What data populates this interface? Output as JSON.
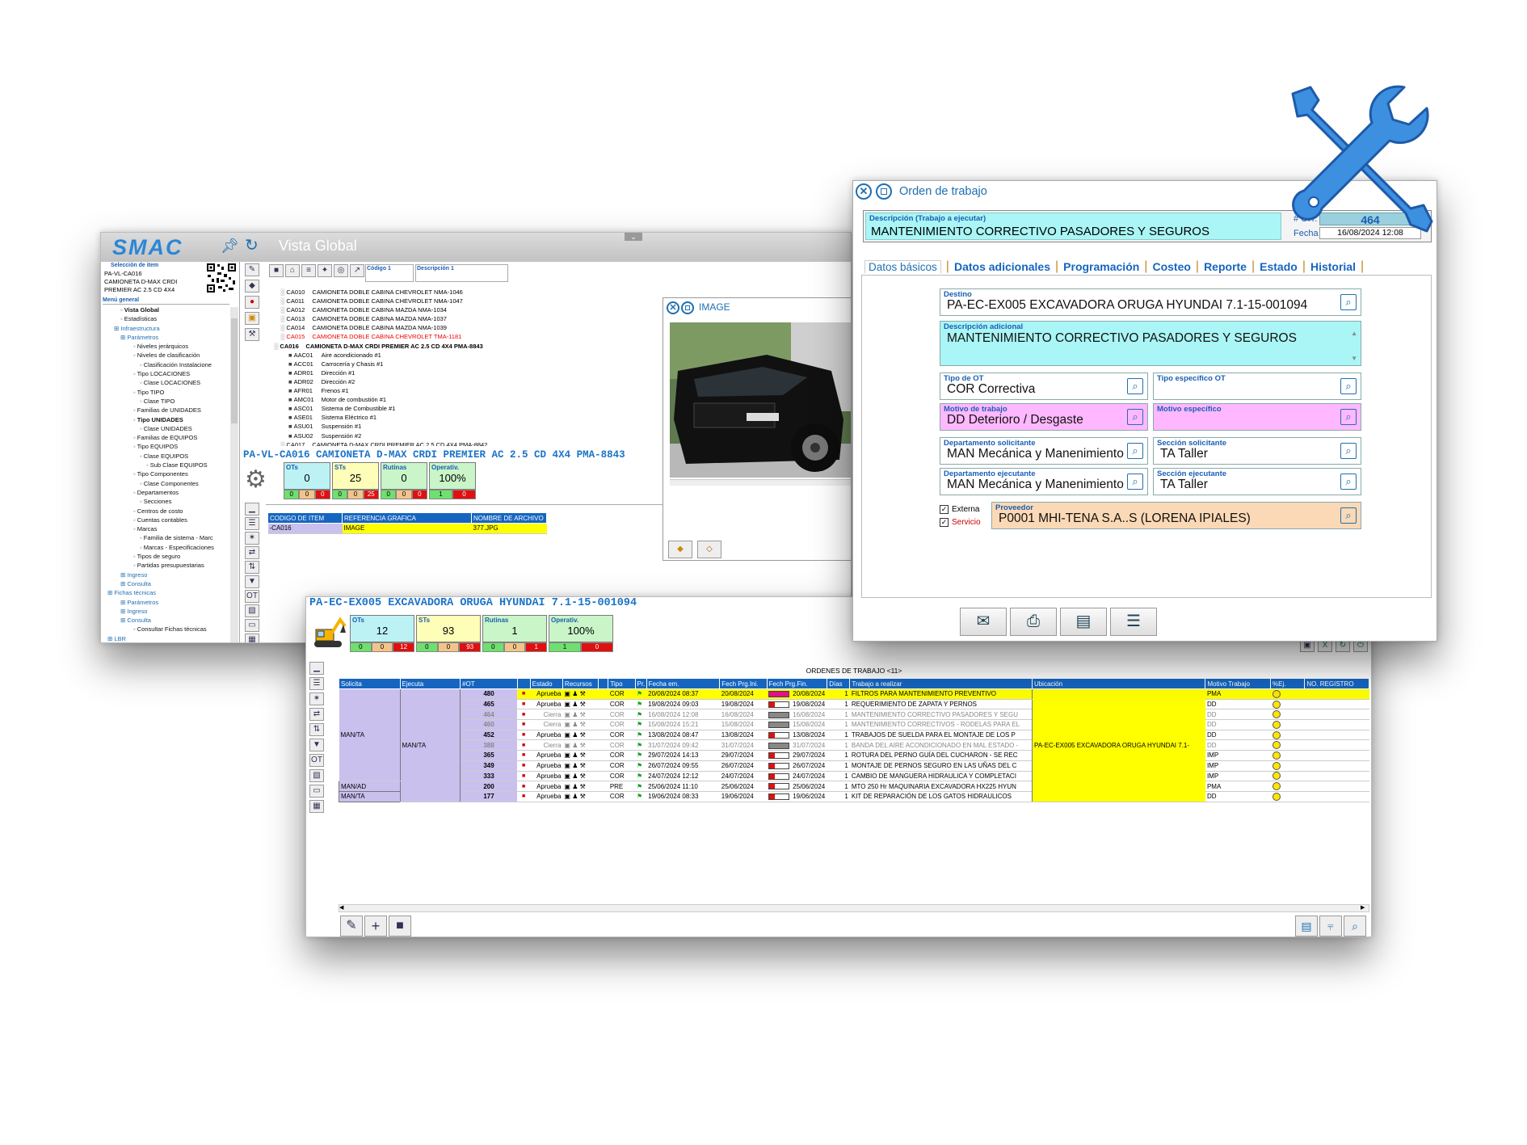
{
  "w1": {
    "logo": "SMAC",
    "title": "Vista Global",
    "item_selection_label": "Selección de item",
    "item_code_lines": [
      "PA-VL-CA016",
      "CAMIONETA D-MAX CRDI",
      "PREMIER AC 2.5  CD 4X4"
    ],
    "menu_label": "Menú general",
    "menu": [
      {
        "t": "Vista Global",
        "b": true,
        "i": 2
      },
      {
        "t": "Estadísticas",
        "i": 2
      },
      {
        "t": "Infraestructura",
        "i": 1,
        "c": "b"
      },
      {
        "t": "Parámetros",
        "i": 2,
        "c": "b"
      },
      {
        "t": "Niveles jerárquicos",
        "i": 4
      },
      {
        "t": "Niveles de clasificación",
        "i": 4
      },
      {
        "t": "Clasificación Instalacione",
        "i": 5
      },
      {
        "t": "Tipo LOCACIONES",
        "i": 4
      },
      {
        "t": "Clase LOCACIONES",
        "i": 5
      },
      {
        "t": "Tipo TIPO",
        "i": 4
      },
      {
        "t": "Clase TIPO",
        "i": 5
      },
      {
        "t": "Familias de UNIDADES",
        "i": 4
      },
      {
        "t": "Tipo UNIDADES",
        "i": 4,
        "b": true
      },
      {
        "t": "Clase UNIDADES",
        "i": 5
      },
      {
        "t": "Familias de EQUIPOS",
        "i": 4
      },
      {
        "t": "Tipo EQUIPOS",
        "i": 4
      },
      {
        "t": "Clase EQUIPOS",
        "i": 5
      },
      {
        "t": "Sub Clase EQUIPOS",
        "i": 6
      },
      {
        "t": "Tipo Componentes",
        "i": 4
      },
      {
        "t": "Clase Componentes",
        "i": 5
      },
      {
        "t": "Departamentos",
        "i": 4
      },
      {
        "t": "Secciones",
        "i": 5
      },
      {
        "t": "Centros de costo",
        "i": 4
      },
      {
        "t": "Cuentas contables",
        "i": 4
      },
      {
        "t": "Marcas",
        "i": 4
      },
      {
        "t": "Familia de sistema - Marc",
        "i": 5
      },
      {
        "t": "Marcas - Especificaciones",
        "i": 5
      },
      {
        "t": "Tipos de seguro",
        "i": 4
      },
      {
        "t": "Partidas presupuestarias",
        "i": 4
      },
      {
        "t": "Ingreso",
        "i": 2,
        "c": "b"
      },
      {
        "t": "Consulta",
        "i": 2,
        "c": "b"
      },
      {
        "t": "Fichas técnicas",
        "i": 0,
        "c": "b"
      },
      {
        "t": "Parámetros",
        "i": 2,
        "c": "b"
      },
      {
        "t": "Ingreso",
        "i": 2,
        "c": "b"
      },
      {
        "t": "Consulta",
        "i": 2,
        "c": "b"
      },
      {
        "t": "Consultar Fichas técnicas",
        "i": 4
      },
      {
        "t": "LBR",
        "i": 0,
        "c": "b"
      }
    ],
    "col_codigo": "Código 1",
    "col_descripcion": "Descripción 1",
    "tree": [
      {
        "code": "CA010",
        "desc": "CAMIONETA DOBLE CABINA CHEVROLET  NMA-1046"
      },
      {
        "code": "CA011",
        "desc": "CAMIONETA DOBLE CABINA CHEVROLET  NMA-1047"
      },
      {
        "code": "CA012",
        "desc": "CAMIONETA DOBLE CABINA MAZDA  NMA-1034"
      },
      {
        "code": "CA013",
        "desc": "CAMIONETA DOBLE CABINA MAZDA  NMA-1037"
      },
      {
        "code": "CA014",
        "desc": "CAMIONETA DOBLE CABINA MAZDA  NMA-1039"
      },
      {
        "code": "CA015",
        "desc": "CAMIONETA DOBLE CABINA CHEVROLET  TMA-1181",
        "red": true
      },
      {
        "code": "CA016",
        "desc": "CAMIONETA D-MAX CRDI PREMIER AC 2.5  CD 4X4  PMA-8843",
        "bold": true
      },
      {
        "code": "AAC01",
        "desc": "Aire acondicionado #1",
        "sub": true
      },
      {
        "code": "ACC01",
        "desc": "Carrocería y Chasis #1",
        "sub": true
      },
      {
        "code": "ADR01",
        "desc": "Dirección #1",
        "sub": true
      },
      {
        "code": "ADR02",
        "desc": "Dirección #2",
        "sub": true
      },
      {
        "code": "AFR01",
        "desc": "Frenos #1",
        "sub": true
      },
      {
        "code": "AMC01",
        "desc": "Motor de combustión #1",
        "sub": true
      },
      {
        "code": "ASC01",
        "desc": "Sistema de Combustible #1",
        "sub": true
      },
      {
        "code": "ASE01",
        "desc": "Sistema Eléctrico #1",
        "sub": true
      },
      {
        "code": "ASU01",
        "desc": "Suspensión #1",
        "sub": true
      },
      {
        "code": "ASU02",
        "desc": "Suspensión #2",
        "sub": true
      },
      {
        "code": "CA017",
        "desc": "CAMIONETA D-MAX CRDI PREMIER AC 2.5 CD 4X4 PMA-8842"
      }
    ],
    "selected_title": "PA-VL-CA016   CAMIONETA D-MAX CRDI PREMIER AC 2.5  CD 4X4  PMA-8843",
    "kpis": [
      {
        "label": "OTs",
        "value": "0",
        "sub": [
          "0",
          "0",
          "0"
        ]
      },
      {
        "label": "STs",
        "value": "25",
        "sub": [
          "0",
          "0",
          "25"
        ]
      },
      {
        "label": "Rutinas",
        "value": "0",
        "sub": [
          "0",
          "0",
          "0"
        ]
      },
      {
        "label": "Operativ.",
        "value": "100%",
        "sub": [
          "1",
          "0"
        ]
      }
    ],
    "img_headers": [
      "CODIGO DE ITEM",
      "REFERENCIA GRAFICA",
      "NOMBRE DE ARCHIVO"
    ],
    "img_row": [
      "-CA016",
      "IMAGE",
      "377.JPG"
    ],
    "image_window_title": "IMAGE"
  },
  "w2": {
    "title": "Orden de trabajo",
    "desc_label": "Descripción (Trabajo a ejecutar)",
    "desc_value": "MANTENIMIENTO CORRECTIVO PASADORES Y SEGUROS",
    "ot_label": "# O.T.",
    "ot_value": "464",
    "fecha_label": "Fecha",
    "fecha_value": "16/08/2024 12:08",
    "tabs": [
      "Datos básicos",
      "Datos adicionales",
      "Programación",
      "Costeo",
      "Reporte",
      "Estado",
      "Historial"
    ],
    "destino_label": "Destino",
    "destino_value": "PA-EC-EX005 EXCAVADORA ORUGA HYUNDAI 7.1-15-001094",
    "desc_adic_label": "Descripción adicional",
    "desc_adic_value": "MANTENIMIENTO CORRECTIVO PASADORES Y SEGUROS",
    "tipo_ot_label": "Tipo de OT",
    "tipo_ot_value": "COR Correctiva",
    "tipo_esp_label": "Tipo específico OT",
    "motivo_label": "Motivo de trabajo",
    "motivo_value": "DD Deterioro / Desgaste",
    "motivo_esp_label": "Motivo específico",
    "dep_sol_label": "Departamento solicitante",
    "dep_sol_value": "MAN Mecánica y Manenimiento",
    "sec_sol_label": "Sección solicitante",
    "sec_sol_value": "TA Taller",
    "dep_eje_label": "Departamento ejecutante",
    "dep_eje_value": "MAN Mecánica y Manenimiento",
    "sec_eje_label": "Sección ejecutante",
    "sec_eje_value": "TA Taller",
    "externa_label": "Externa",
    "servicio_label": "Servicio",
    "proveedor_label": "Proveedor",
    "proveedor_value": "P0001 MHI-TENA S.A..S (LORENA IPIALES)"
  },
  "w3": {
    "equip_title": "PA-EC-EX005   EXCAVADORA ORUGA HYUNDAI 7.1-15-001094",
    "kpis": [
      {
        "label": "OTs",
        "value": "12",
        "sub": [
          "0",
          "0",
          "12"
        ]
      },
      {
        "label": "STs",
        "value": "93",
        "sub": [
          "0",
          "0",
          "93"
        ]
      },
      {
        "label": "Rutinas",
        "value": "1",
        "sub": [
          "0",
          "0",
          "1"
        ]
      },
      {
        "label": "Operativ.",
        "value": "100%",
        "sub": [
          "1",
          "0"
        ]
      }
    ],
    "orders_title": "ORDENES DE TRABAJO <11>",
    "headers": [
      "Solicita",
      "Ejecuta",
      "#OT",
      "",
      "Estado",
      "Recursos",
      "",
      "Tipo",
      "Pr.",
      "Fecha em.",
      "Fech Prg.Ini.",
      "Fech Prg.Fin.",
      "Días",
      "Trabajo a realizar",
      "Ubicación",
      "Motivo Trabajo",
      "%Ej.",
      "NO. REGISTRO"
    ],
    "group_solicita_1": "MAN/TA",
    "group_ejecuta_1": "MAN/TA",
    "ubicacion": "PA-EC-EX005  EXCAVADORA ORUGA HYUNDAI 7.1-",
    "rows": [
      {
        "sol": "",
        "eje": "",
        "ot": "480",
        "estado": "Aprueba",
        "tipo": "COR",
        "fem": "20/08/2024 08:37",
        "fini": "20/08/2024",
        "ffin": "20/08/2024",
        "dias": "1",
        "trabajo": "FILTROS PARA MANTENIMIENTO PREVENTIVO",
        "motivo": "PMA",
        "sel": true
      },
      {
        "sol": "",
        "eje": "",
        "ot": "465",
        "estado": "Aprueba",
        "tipo": "COR",
        "fem": "19/08/2024 09:03",
        "fini": "19/08/2024",
        "ffin": "19/08/2024",
        "dias": "1",
        "trabajo": "REQUERIMIENTO DE ZAPATA Y PERNOS",
        "motivo": "DD"
      },
      {
        "sol": "",
        "eje": "",
        "ot": "464",
        "estado": "Cierra",
        "tipo": "COR",
        "fem": "16/08/2024 12:08",
        "fini": "16/08/2024",
        "ffin": "16/08/2024",
        "dias": "1",
        "trabajo": "MANTENIMIENTO CORRECTIVO PASADORES Y SEGU",
        "motivo": "DD",
        "grey": true
      },
      {
        "sol": "",
        "eje": "",
        "ot": "460",
        "estado": "Cierra",
        "tipo": "COR",
        "fem": "15/08/2024 15:21",
        "fini": "15/08/2024",
        "ffin": "15/08/2024",
        "dias": "1",
        "trabajo": "MANTENIMIENTO CORRECTIVOS - RODELAS PARA EL",
        "motivo": "DD",
        "grey": true
      },
      {
        "sol": "",
        "eje": "",
        "ot": "452",
        "estado": "Aprueba",
        "tipo": "COR",
        "fem": "13/08/2024 08:47",
        "fini": "13/08/2024",
        "ffin": "13/08/2024",
        "dias": "1",
        "trabajo": "TRABAJOS DE SUELDA PARA EL MONTAJE DE LOS P",
        "motivo": "DD"
      },
      {
        "sol": "",
        "eje": "",
        "ot": "388",
        "estado": "Cierra",
        "tipo": "COR",
        "fem": "31/07/2024 09:42",
        "fini": "31/07/2024",
        "ffin": "31/07/2024",
        "dias": "1",
        "trabajo": "BANDA DEL AIRE ACONDICIONADO EN MAL ESTADO -",
        "motivo": "DD",
        "grey": true
      },
      {
        "sol": "",
        "eje": "",
        "ot": "365",
        "estado": "Aprueba",
        "tipo": "COR",
        "fem": "29/07/2024 14:13",
        "fini": "29/07/2024",
        "ffin": "29/07/2024",
        "dias": "1",
        "trabajo": "ROTURA DEL PERNO GUÍA DEL CUCHARON - SE REC",
        "motivo": "IMP"
      },
      {
        "sol": "",
        "eje": "",
        "ot": "349",
        "estado": "Aprueba",
        "tipo": "COR",
        "fem": "26/07/2024 09:55",
        "fini": "26/07/2024",
        "ffin": "26/07/2024",
        "dias": "1",
        "trabajo": "MONTAJE DE PERNOS SEGURO EN LAS UÑAS DEL C",
        "motivo": "IMP"
      },
      {
        "sol": "",
        "eje": "",
        "ot": "333",
        "estado": "Aprueba",
        "tipo": "COR",
        "fem": "24/07/2024 12:12",
        "fini": "24/07/2024",
        "ffin": "24/07/2024",
        "dias": "1",
        "trabajo": "CAMBIO DE MANGUERA HIDRAULICA Y COMPLETACI",
        "motivo": "IMP"
      },
      {
        "sol": "MAN/AD",
        "eje": "",
        "ot": "200",
        "estado": "Aprueba",
        "tipo": "PRE",
        "fem": "25/06/2024 11:10",
        "fini": "25/06/2024",
        "ffin": "25/06/2024",
        "dias": "1",
        "trabajo": "MTO 250 Hr MAQUINARIA EXCAVADORA HX225 HYUN",
        "motivo": "PMA"
      },
      {
        "sol": "MAN/TA",
        "eje": "",
        "ot": "177",
        "estado": "Aprueba",
        "tipo": "COR",
        "fem": "19/06/2024 08:33",
        "fini": "19/06/2024",
        "ffin": "19/06/2024",
        "dias": "1",
        "trabajo": "KIT DE REPARACIÓN DE LOS GATOS HIDRAULICOS",
        "motivo": "DD"
      }
    ]
  }
}
